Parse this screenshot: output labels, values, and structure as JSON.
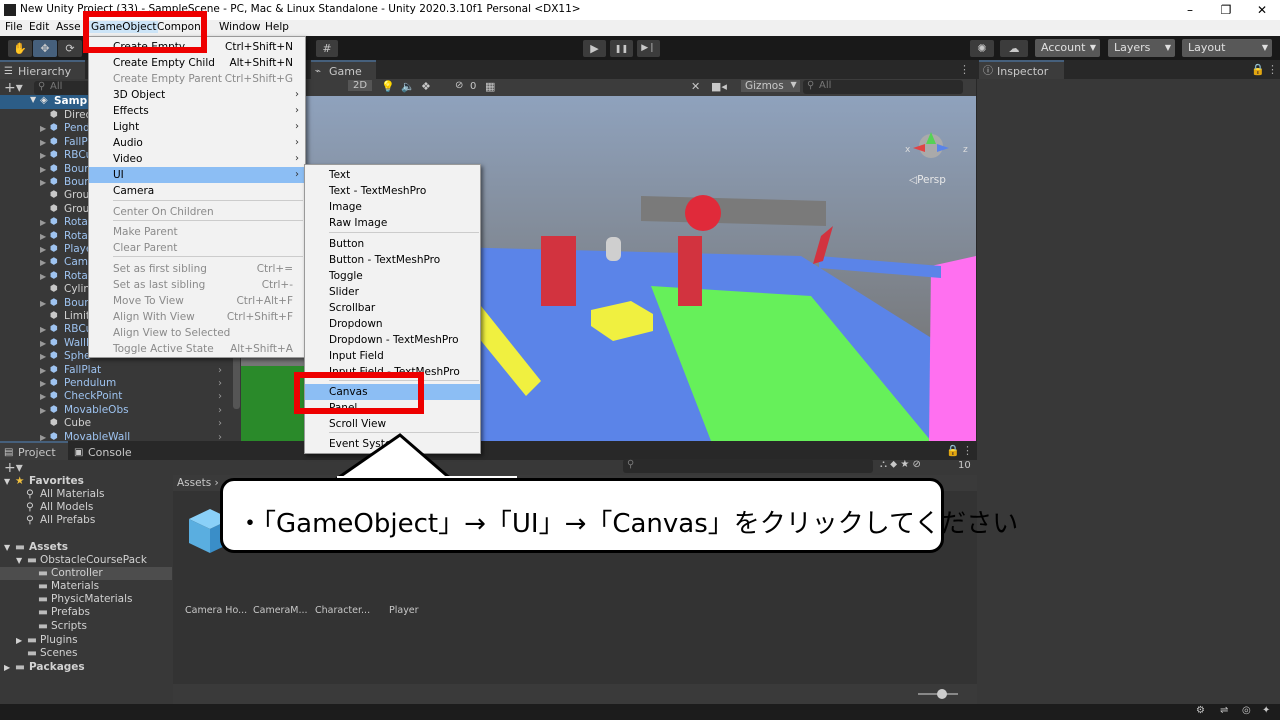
{
  "window": {
    "title": "New Unity Project (33) - SampleScene - PC, Mac & Linux Standalone - Unity 2020.3.10f1 Personal <DX11>",
    "controls": [
      "–",
      "❐",
      "✕"
    ]
  },
  "menubar": {
    "items": [
      "File",
      "Edit",
      "Asse",
      "GameObject",
      "Compone",
      "Window",
      "Help"
    ]
  },
  "toolbar": {
    "play_icons": [
      "▶",
      "❚❚",
      "▶❘"
    ],
    "account": "Account",
    "layers": "Layers",
    "layout": "Layout"
  },
  "hierarchy": {
    "tab": "Hierarchy",
    "search_placeholder": "All",
    "scene": "Sample",
    "rows": [
      {
        "label": "Direc",
        "plain": true
      },
      {
        "label": "Pend",
        "plain": false
      },
      {
        "label": "FallP",
        "plain": false
      },
      {
        "label": "RBCu",
        "plain": false
      },
      {
        "label": "Boun",
        "plain": false
      },
      {
        "label": "Boun",
        "plain": false
      },
      {
        "label": "Grou",
        "plain": true
      },
      {
        "label": "Grou",
        "plain": true
      },
      {
        "label": "Rotat",
        "plain": false
      },
      {
        "label": "Rotat",
        "plain": false
      },
      {
        "label": "Playe",
        "plain": false
      },
      {
        "label": "Came",
        "plain": false
      },
      {
        "label": "Rotat",
        "plain": false
      },
      {
        "label": "Cylin",
        "plain": true
      },
      {
        "label": "Boun",
        "plain": false
      },
      {
        "label": "Limit",
        "plain": true
      },
      {
        "label": "RBCu",
        "plain": false
      },
      {
        "label": "WallM",
        "plain": false
      },
      {
        "label": "Sphe",
        "plain": false
      },
      {
        "label": "FallPlat",
        "plain": false
      },
      {
        "label": "Pendulum",
        "plain": false
      },
      {
        "label": "CheckPoint",
        "plain": false
      },
      {
        "label": "MovableObs",
        "plain": false
      },
      {
        "label": "Cube",
        "plain": true
      },
      {
        "label": "MovableWall",
        "plain": false
      }
    ]
  },
  "game_view": {
    "tab": "Game",
    "toolbar": {
      "mode": "2D",
      "gizmos": "Gizmos",
      "search": "All",
      "count": "0"
    },
    "persp": "◁Persp",
    "axis_x": "x",
    "axis_z": "z"
  },
  "inspector": {
    "tab": "Inspector"
  },
  "project": {
    "tab": "Project",
    "console_tab": "Console",
    "favorites": {
      "label": "Favorites",
      "items": [
        "All Materials",
        "All Models",
        "All Prefabs"
      ]
    },
    "assets_label": "Assets",
    "course_pack": "ObstacleCoursePack",
    "folders": [
      "Controller",
      "Materials",
      "PhysicMaterials",
      "Prefabs",
      "Scripts"
    ],
    "plugins": "Plugins",
    "scenes": "Scenes",
    "packages": "Packages",
    "breadcrumb": "Assets",
    "hidden_count": "10",
    "files": [
      "Camera Ho...",
      "CameraM...",
      "Character...",
      "Player"
    ]
  },
  "gameobject_menu": {
    "items": [
      {
        "label": "Create Empty",
        "shortcut": "Ctrl+Shift+N",
        "disabled": false,
        "submenu": false
      },
      {
        "label": "Create Empty Child",
        "shortcut": "Alt+Shift+N",
        "disabled": false,
        "submenu": false
      },
      {
        "label": "Create Empty Parent",
        "shortcut": "Ctrl+Shift+G",
        "disabled": true,
        "submenu": false
      },
      {
        "label": "3D Object",
        "shortcut": "",
        "disabled": false,
        "submenu": true
      },
      {
        "label": "Effects",
        "shortcut": "",
        "disabled": false,
        "submenu": true
      },
      {
        "label": "Light",
        "shortcut": "",
        "disabled": false,
        "submenu": true
      },
      {
        "label": "Audio",
        "shortcut": "",
        "disabled": false,
        "submenu": true
      },
      {
        "label": "Video",
        "shortcut": "",
        "disabled": false,
        "submenu": true
      },
      {
        "label": "UI",
        "shortcut": "",
        "disabled": false,
        "submenu": true
      },
      {
        "label": "Camera",
        "shortcut": "",
        "disabled": false,
        "submenu": false
      },
      {
        "label": "Center On Children",
        "shortcut": "",
        "disabled": true,
        "submenu": false
      },
      {
        "label": "Make Parent",
        "shortcut": "",
        "disabled": true,
        "submenu": false
      },
      {
        "label": "Clear Parent",
        "shortcut": "",
        "disabled": true,
        "submenu": false
      },
      {
        "label": "Set as first sibling",
        "shortcut": "Ctrl+=",
        "disabled": true,
        "submenu": false
      },
      {
        "label": "Set as last sibling",
        "shortcut": "Ctrl+-",
        "disabled": true,
        "submenu": false
      },
      {
        "label": "Move To View",
        "shortcut": "Ctrl+Alt+F",
        "disabled": true,
        "submenu": false
      },
      {
        "label": "Align With View",
        "shortcut": "Ctrl+Shift+F",
        "disabled": true,
        "submenu": false
      },
      {
        "label": "Align View to Selected",
        "shortcut": "",
        "disabled": true,
        "submenu": false
      },
      {
        "label": "Toggle Active State",
        "shortcut": "Alt+Shift+A",
        "disabled": true,
        "submenu": false
      }
    ]
  },
  "ui_submenu": {
    "items": [
      "Text",
      "Text - TextMeshPro",
      "Image",
      "Raw Image",
      "Button",
      "Button - TextMeshPro",
      "Toggle",
      "Slider",
      "Scrollbar",
      "Dropdown",
      "Dropdown - TextMeshPro",
      "Input Field",
      "Input Field - TextMeshPro",
      "Canvas",
      "Panel",
      "Scroll View",
      "Event System"
    ]
  },
  "callout": {
    "text": "・「GameObject」→「UI」→「Canvas」をクリックしてください"
  },
  "colors": {
    "highlight": "#8cbef4",
    "annotation_red": "#ee0000",
    "selection_blue": "#2c5d87"
  }
}
